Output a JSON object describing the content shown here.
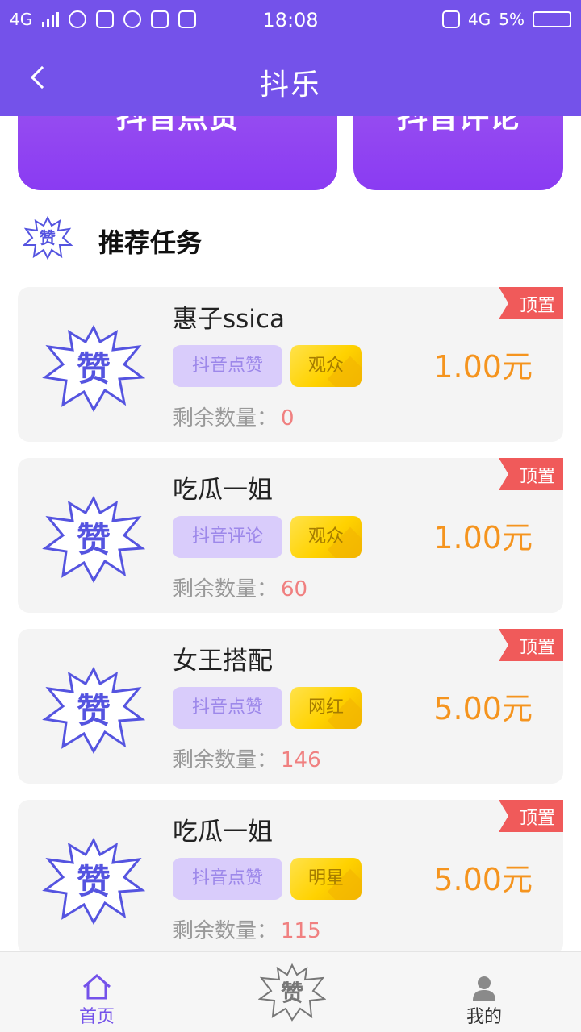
{
  "status_bar": {
    "network_left": "4G",
    "time": "18:08",
    "network_right": "4G",
    "battery": "5%"
  },
  "header": {
    "title": "抖乐"
  },
  "top_cards": [
    {
      "label": "抖音点赞"
    },
    {
      "label": "抖音评论"
    }
  ],
  "section": {
    "title": "推荐任务"
  },
  "remain_label": "剩余数量：",
  "pin_label": "顶置",
  "tasks": [
    {
      "name": "惠子ssica",
      "type": "抖音点赞",
      "level": "观众",
      "price": "1.00元",
      "remain": "0"
    },
    {
      "name": "吃瓜一姐",
      "type": "抖音评论",
      "level": "观众",
      "price": "1.00元",
      "remain": "60"
    },
    {
      "name": "女王搭配",
      "type": "抖音点赞",
      "level": "网红",
      "price": "5.00元",
      "remain": "146"
    },
    {
      "name": "吃瓜一姐",
      "type": "抖音点赞",
      "level": "明星",
      "price": "5.00元",
      "remain": "115"
    }
  ],
  "bottom_nav": {
    "home": "首页",
    "me": "我的"
  },
  "colors": {
    "brand": "#7452ea",
    "price": "#f5941e",
    "pin": "#f05a5a"
  }
}
